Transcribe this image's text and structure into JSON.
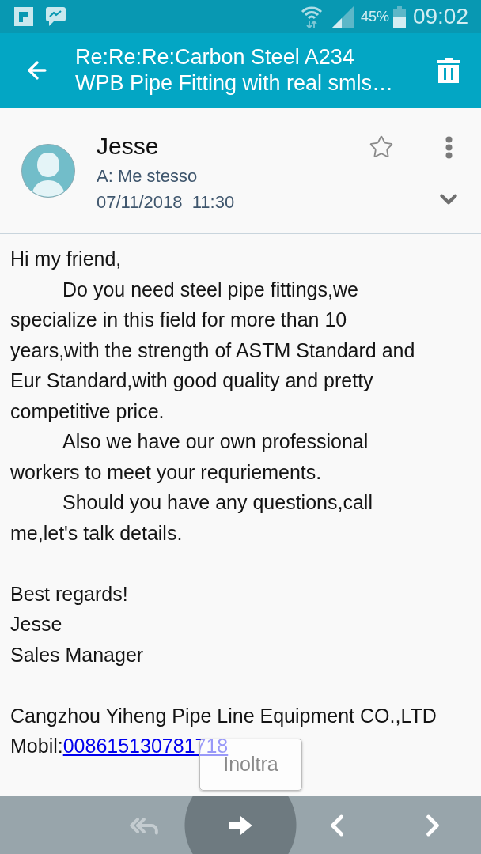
{
  "status_bar": {
    "battery": "45%",
    "time": "09:02"
  },
  "app_bar": {
    "title": "Re:Re:Re:Carbon Steel A234\nWPB Pipe Fitting with real smls…"
  },
  "message": {
    "sender": "Jesse",
    "recipient": "A: Me stesso",
    "date": "07/11/2018  11:30",
    "starred": false
  },
  "body": {
    "sections": [
      [
        {
          "text": "Hi my friend,",
          "indented": false
        },
        {
          "text": "Do you need steel pipe fittings,we\nspecialize in this field for more than 10\nyears,with the strength of ASTM Standard and\nEur Standard,with good quality and pretty\ncompetitive price.",
          "indented": true
        },
        {
          "text": "Also we have our own professional\nworkers to meet your requriements.",
          "indented": true
        },
        {
          "text": "Should you have any questions,call\nme,let's talk details.",
          "indented": true
        }
      ],
      [
        {
          "text": "Best regards!",
          "indented": false
        },
        {
          "text": "Jesse",
          "indented": false
        },
        {
          "text": "Sales Manager",
          "indented": false
        }
      ],
      [
        {
          "text": "Cangzhou Yiheng Pipe Line Equipment CO.,LTD",
          "indented": false
        },
        {
          "text": "Mobil:",
          "indented": false,
          "link": "008615130781718"
        }
      ]
    ]
  },
  "toolbar": {
    "actions": [
      {
        "kind": "reply_all",
        "disabled": true,
        "pressed": false
      },
      {
        "kind": "forward",
        "disabled": false,
        "pressed": true,
        "tooltip": "Inoltra"
      },
      {
        "kind": "previous",
        "disabled": false,
        "pressed": false
      },
      {
        "kind": "next",
        "disabled": false,
        "pressed": false
      }
    ]
  }
}
